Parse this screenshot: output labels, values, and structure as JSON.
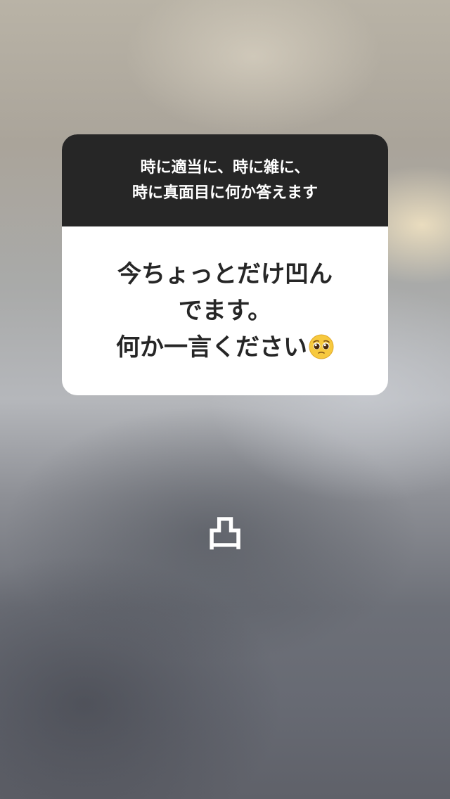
{
  "question_card": {
    "prompt_lines": [
      "時に適当に、時に雑に、",
      "時に真面目に何か答えます"
    ],
    "question_lines": [
      "今ちょっとだけ凹ん",
      "でます。",
      "何か一言ください"
    ],
    "question_emoji": "pleading-face-emoji"
  },
  "answer": {
    "text": "凸"
  },
  "colors": {
    "header_bg": "#262626",
    "card_bg": "#ffffff",
    "question_text": "#262626",
    "answer_text": "#ffffff"
  }
}
